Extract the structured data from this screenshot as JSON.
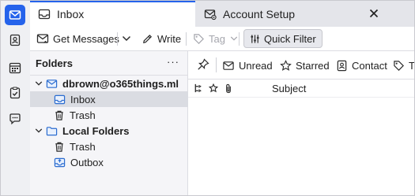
{
  "tabs": [
    {
      "label": "Inbox",
      "icon": "inbox-tab-icon",
      "selected": true
    },
    {
      "label": "Account Setup",
      "icon": "account-setup-icon",
      "selected": false
    }
  ],
  "toolbar": {
    "get_messages": "Get Messages",
    "write": "Write",
    "tag": "Tag",
    "quick_filter": "Quick Filter"
  },
  "folder_pane": {
    "title": "Folders",
    "menu": "···",
    "account": "dbrown@o365things.ml",
    "account_folders": [
      "Inbox",
      "Trash"
    ],
    "local_folders": "Local Folders",
    "local_items": [
      "Trash",
      "Outbox"
    ]
  },
  "quick_filter_bar": {
    "unread": "Unread",
    "starred": "Starred",
    "contact": "Contact",
    "tags": "Ta"
  },
  "thread_columns": {
    "subject": "Subject"
  },
  "colors": {
    "accent": "#2563eb",
    "selected_row": "#dadce2",
    "folder_blue": "#2b6cd0"
  }
}
